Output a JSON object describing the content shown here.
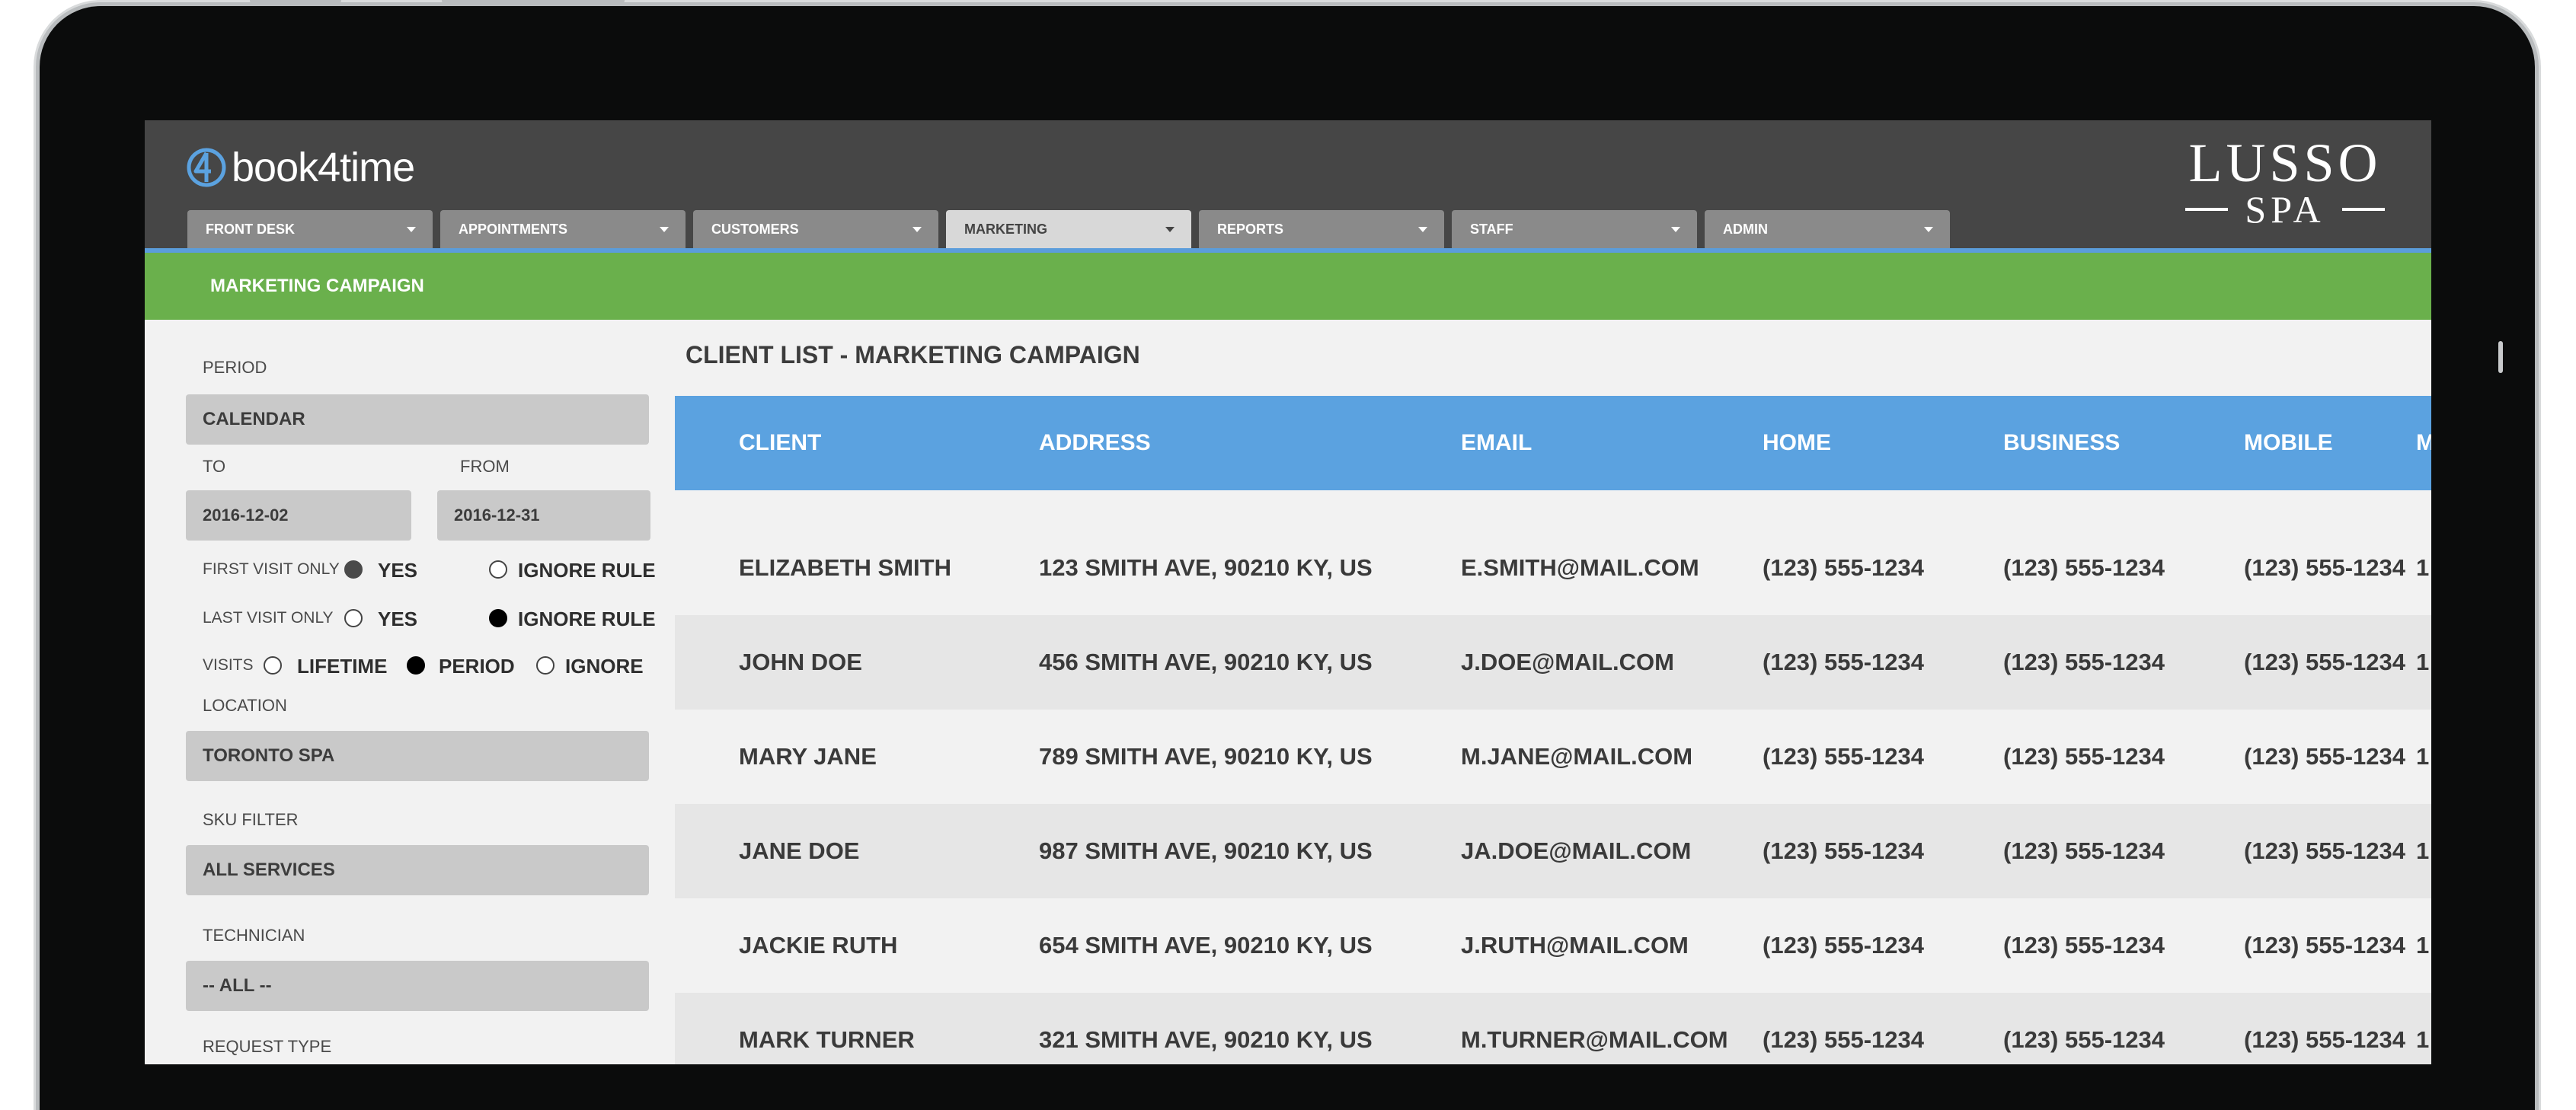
{
  "app": {
    "logo_text": "book4time",
    "brand_top": "LUSSO",
    "brand_bottom": "SPA"
  },
  "nav": [
    {
      "label": "FRONT DESK"
    },
    {
      "label": "APPOINTMENTS"
    },
    {
      "label": "CUSTOMERS"
    },
    {
      "label": "MARKETING",
      "active": true
    },
    {
      "label": "REPORTS"
    },
    {
      "label": "STAFF"
    },
    {
      "label": "ADMIN"
    }
  ],
  "section_title": "MARKETING CAMPAIGN",
  "filters": {
    "period_label": "PERIOD",
    "period_value": "CALENDAR",
    "to_label": "TO",
    "to_value": "2016-12-02",
    "from_label": "FROM",
    "from_value": "2016-12-31",
    "first_visit_label": "FIRST VISIT ONLY",
    "first_visit_yes": "YES",
    "first_visit_ignore": "IGNORE RULE",
    "first_visit_selected": "YES",
    "last_visit_label": "LAST VISIT ONLY",
    "last_visit_yes": "YES",
    "last_visit_ignore": "IGNORE RULE",
    "last_visit_selected": "IGNORE RULE",
    "visits_label": "VISITS",
    "visits_lifetime": "LIFETIME",
    "visits_period": "PERIOD",
    "visits_ignore": "IGNORE",
    "visits_selected": "PERIOD",
    "location_label": "LOCATION",
    "location_value": "TORONTO SPA",
    "sku_label": "SKU FILTER",
    "sku_value": "ALL SERVICES",
    "technician_label": "TECHNICIAN",
    "technician_value": "-- ALL --",
    "request_type_label": "REQUEST TYPE"
  },
  "table": {
    "title": "CLIENT LIST - MARKETING CAMPAIGN",
    "columns": [
      "CLIENT",
      "ADDRESS",
      "EMAIL",
      "HOME",
      "BUSINESS",
      "MOBILE",
      "M"
    ],
    "rows": [
      [
        "ELIZABETH SMITH",
        "123 SMITH AVE, 90210 KY, US",
        "E.SMITH@MAIL.COM",
        "(123) 555-1234",
        "(123) 555-1234",
        "(123) 555-1234",
        "1"
      ],
      [
        "JOHN DOE",
        "456 SMITH AVE, 90210 KY, US",
        "J.DOE@MAIL.COM",
        "(123) 555-1234",
        "(123) 555-1234",
        "(123) 555-1234",
        "1"
      ],
      [
        "MARY JANE",
        "789 SMITH AVE, 90210 KY, US",
        "M.JANE@MAIL.COM",
        "(123) 555-1234",
        "(123) 555-1234",
        "(123) 555-1234",
        "1"
      ],
      [
        "JANE DOE",
        "987 SMITH AVE, 90210 KY, US",
        "JA.DOE@MAIL.COM",
        "(123) 555-1234",
        "(123) 555-1234",
        "(123) 555-1234",
        "1"
      ],
      [
        "JACKIE RUTH",
        "654 SMITH AVE, 90210 KY, US",
        "J.RUTH@MAIL.COM",
        "(123) 555-1234",
        "(123) 555-1234",
        "(123) 555-1234",
        "1"
      ],
      [
        "MARK TURNER",
        "321 SMITH AVE, 90210 KY, US",
        "M.TURNER@MAIL.COM",
        "(123) 555-1234",
        "(123) 555-1234",
        "(123) 555-1234",
        "1"
      ]
    ]
  },
  "colors": {
    "header": "#464646",
    "green_bar": "#6ab04c",
    "table_header": "#5ba2e0"
  }
}
